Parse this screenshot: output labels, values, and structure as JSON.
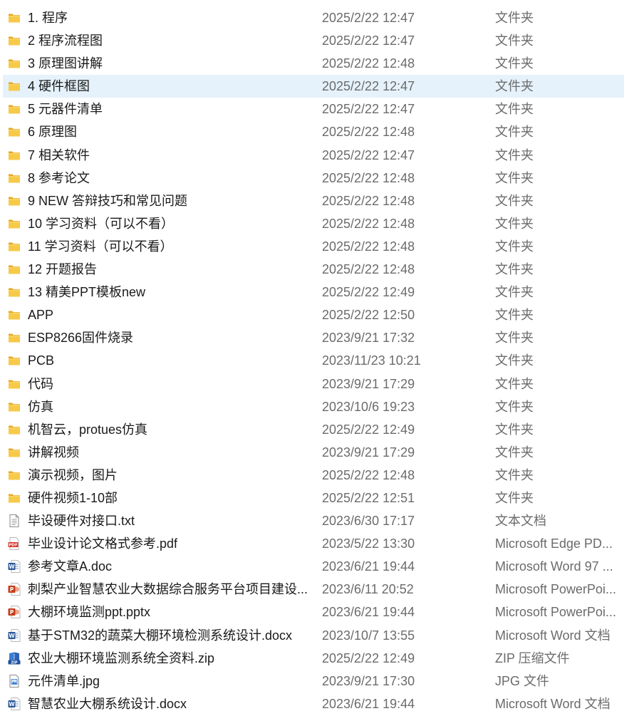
{
  "files": [
    {
      "name": "1. 程序",
      "date": "2025/2/22 12:47",
      "type": "文件夹",
      "icon": "folder-icon"
    },
    {
      "name": "2  程序流程图",
      "date": "2025/2/22 12:47",
      "type": "文件夹",
      "icon": "folder-icon"
    },
    {
      "name": "3  原理图讲解",
      "date": "2025/2/22 12:48",
      "type": "文件夹",
      "icon": "folder-icon"
    },
    {
      "name": "4 硬件框图",
      "date": "2025/2/22 12:47",
      "type": "文件夹",
      "icon": "folder-icon",
      "selected": true
    },
    {
      "name": "5 元器件清单",
      "date": "2025/2/22 12:47",
      "type": "文件夹",
      "icon": "folder-icon"
    },
    {
      "name": "6  原理图",
      "date": "2025/2/22 12:48",
      "type": "文件夹",
      "icon": "folder-icon"
    },
    {
      "name": "7 相关软件",
      "date": "2025/2/22 12:47",
      "type": "文件夹",
      "icon": "folder-icon"
    },
    {
      "name": "8 参考论文",
      "date": "2025/2/22 12:48",
      "type": "文件夹",
      "icon": "folder-icon"
    },
    {
      "name": "9  NEW 答辩技巧和常见问题",
      "date": "2025/2/22 12:48",
      "type": "文件夹",
      "icon": "folder-icon"
    },
    {
      "name": "10 学习资料（可以不看）",
      "date": "2025/2/22 12:48",
      "type": "文件夹",
      "icon": "folder-icon"
    },
    {
      "name": "11 学习资料（可以不看）",
      "date": "2025/2/22 12:48",
      "type": "文件夹",
      "icon": "folder-icon"
    },
    {
      "name": "12  开题报告",
      "date": "2025/2/22 12:48",
      "type": "文件夹",
      "icon": "folder-icon"
    },
    {
      "name": "13   精美PPT模板new",
      "date": "2025/2/22 12:49",
      "type": "文件夹",
      "icon": "folder-icon"
    },
    {
      "name": "APP",
      "date": "2025/2/22 12:50",
      "type": "文件夹",
      "icon": "folder-icon"
    },
    {
      "name": "ESP8266固件烧录",
      "date": "2023/9/21 17:32",
      "type": "文件夹",
      "icon": "folder-icon"
    },
    {
      "name": "PCB",
      "date": "2023/11/23 10:21",
      "type": "文件夹",
      "icon": "folder-icon"
    },
    {
      "name": "代码",
      "date": "2023/9/21 17:29",
      "type": "文件夹",
      "icon": "folder-icon"
    },
    {
      "name": "仿真",
      "date": "2023/10/6 19:23",
      "type": "文件夹",
      "icon": "folder-icon"
    },
    {
      "name": "机智云，protues仿真",
      "date": "2025/2/22 12:49",
      "type": "文件夹",
      "icon": "folder-icon"
    },
    {
      "name": "讲解视频",
      "date": "2023/9/21 17:29",
      "type": "文件夹",
      "icon": "folder-icon"
    },
    {
      "name": "演示视频，图片",
      "date": "2025/2/22 12:48",
      "type": "文件夹",
      "icon": "folder-icon"
    },
    {
      "name": "硬件视频1-10部",
      "date": "2025/2/22 12:51",
      "type": "文件夹",
      "icon": "folder-icon"
    },
    {
      "name": "毕设硬件对接口.txt",
      "date": "2023/6/30 17:17",
      "type": "文本文档",
      "icon": "text-file-icon"
    },
    {
      "name": "毕业设计论文格式参考.pdf",
      "date": "2023/5/22 13:30",
      "type": "Microsoft Edge PD...",
      "icon": "pdf-file-icon"
    },
    {
      "name": "参考文章A.doc",
      "date": "2023/6/21 19:44",
      "type": "Microsoft Word 97 ...",
      "icon": "word-file-icon"
    },
    {
      "name": "刺梨产业智慧农业大数据综合服务平台项目建设...",
      "date": "2023/6/11 20:52",
      "type": "Microsoft PowerPoi...",
      "icon": "powerpoint-file-icon"
    },
    {
      "name": "大棚环境监测ppt.pptx",
      "date": "2023/6/21 19:44",
      "type": "Microsoft PowerPoi...",
      "icon": "powerpoint-file-icon"
    },
    {
      "name": "基于STM32的蔬菜大棚环境检测系统设计.docx",
      "date": "2023/10/7 13:55",
      "type": "Microsoft Word 文档",
      "icon": "word-file-icon"
    },
    {
      "name": "农业大棚环境监测系统全资料.zip",
      "date": "2025/2/22 12:49",
      "type": "ZIP 压缩文件",
      "icon": "zip-file-icon"
    },
    {
      "name": "元件清单.jpg",
      "date": "2023/9/21 17:30",
      "type": "JPG 文件",
      "icon": "image-file-icon"
    },
    {
      "name": "智慧农业大棚系统设计.docx",
      "date": "2023/6/21 19:44",
      "type": "Microsoft Word 文档",
      "icon": "word-file-icon"
    }
  ],
  "colors": {
    "selection": "#e5f2fb",
    "folder": "#f5c542",
    "date_text": "#6b6b6b",
    "pdf": "#d9342b",
    "word": "#2b5797",
    "powerpoint": "#c43e1c"
  }
}
